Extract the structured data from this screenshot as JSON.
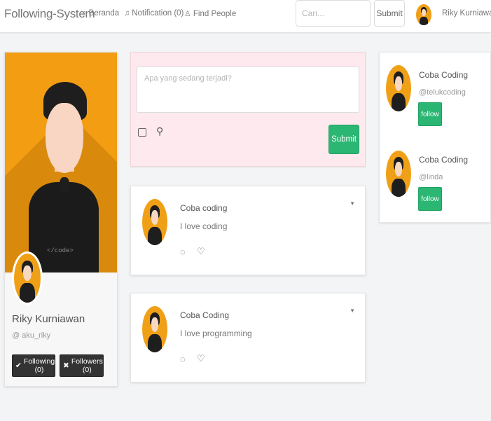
{
  "navbar": {
    "brand": "Following-System",
    "links": [
      {
        "icon": "home-icon",
        "glyph": "⌂",
        "label": "Beranda"
      },
      {
        "icon": "bell-icon",
        "glyph": "♫",
        "label": "Notification (0)"
      },
      {
        "icon": "user-icon",
        "glyph": "♙",
        "label": "Find People"
      }
    ],
    "search_placeholder": "Cari...",
    "search_button": "Submit",
    "user_name": "Riky Kurniawan"
  },
  "profile": {
    "cover_text": "</code>",
    "name": "Riky Kurniawan",
    "handle": "@ aku_riky",
    "following_label": "Following (0)",
    "followers_label": "Followers (0)"
  },
  "composer": {
    "placeholder": "Apa yang sedang terjadi?",
    "submit_label": "Submit"
  },
  "posts": [
    {
      "author": "Coba coding",
      "text": "I love coding"
    },
    {
      "author": "Coba Coding",
      "text": "I love programming"
    }
  ],
  "suggestions": [
    {
      "name": "Coba Coding",
      "handle": "@telukcoding",
      "button": "follow"
    },
    {
      "name": "Coba Coding",
      "handle": "@linda",
      "button": "follow"
    }
  ],
  "colors": {
    "accent_green": "#2bb673",
    "avatar_orange": "#f29d12",
    "composer_bg": "#fde9ee",
    "dark_button": "#333333"
  }
}
